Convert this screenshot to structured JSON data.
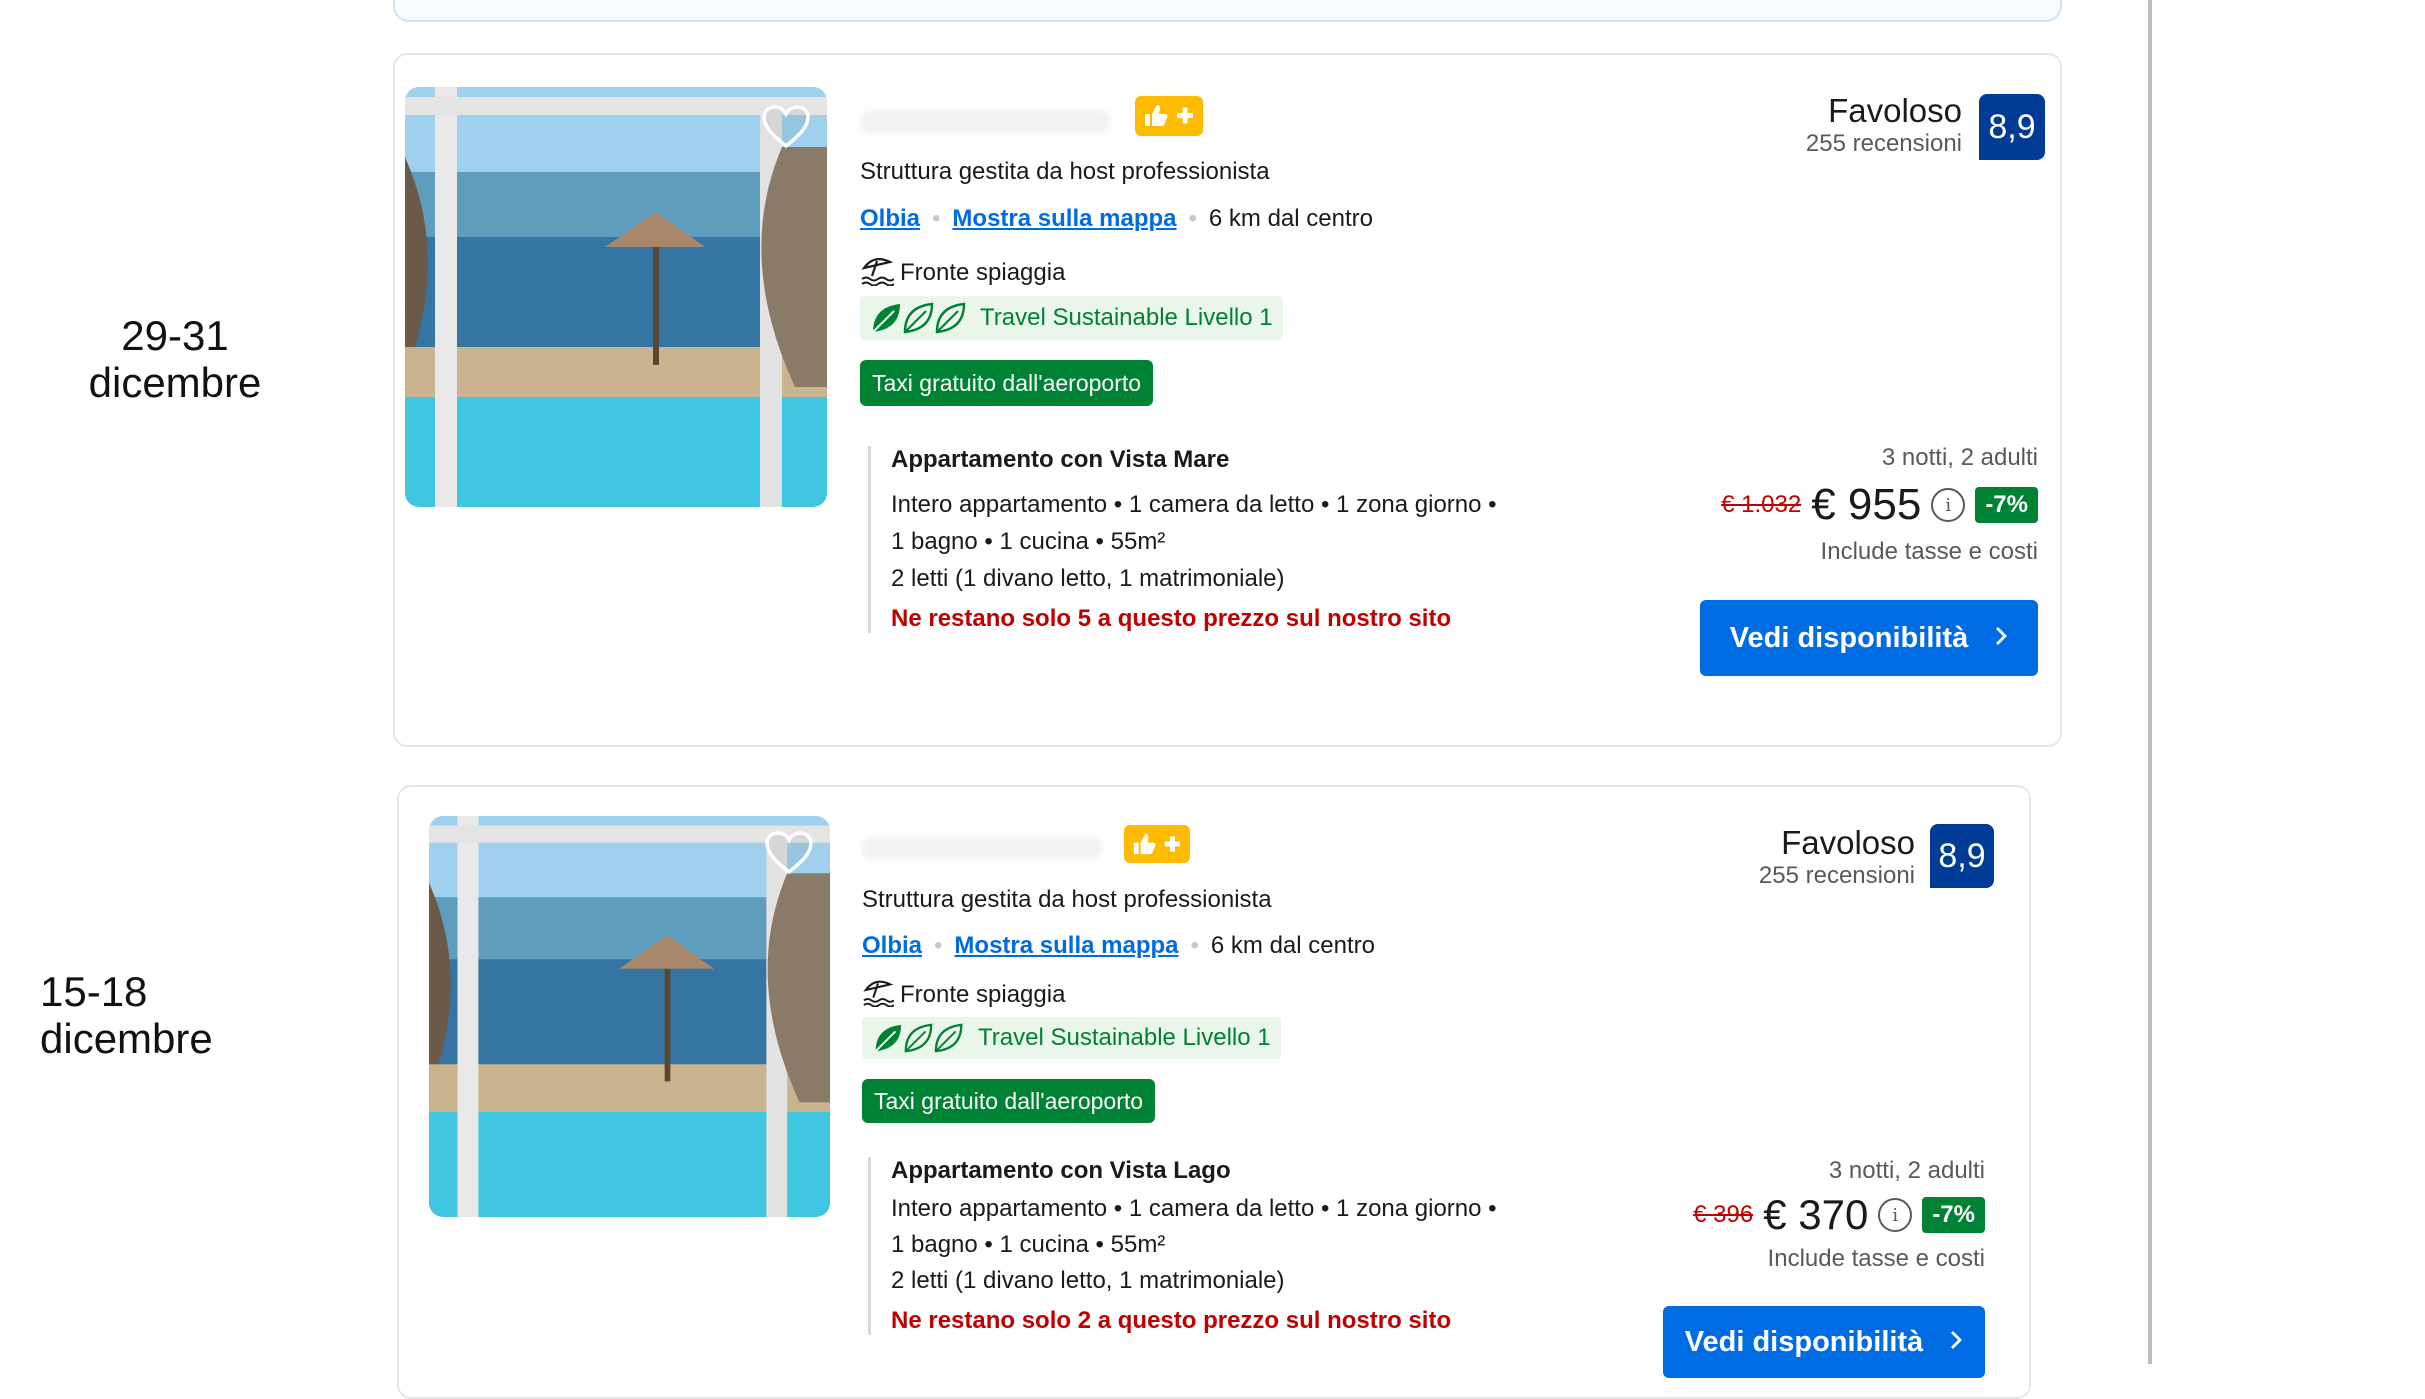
{
  "listings": [
    {
      "date_label": "29-31\ndicembre",
      "host_label": "Struttura gestita da host professionista",
      "city": "Olbia",
      "map_link": "Mostra sulla mappa",
      "distance": "6 km dal centro",
      "beach": "Fronte spiaggia",
      "sustainable": "Travel Sustainable Livello 1",
      "taxi": "Taxi gratuito dall'aeroporto",
      "room_title": "Appartamento con Vista Mare",
      "room_line1": "Intero appartamento • 1 camera da letto • 1 zona giorno •",
      "room_line2": "1 bagno • 1 cucina • 55m²",
      "room_line3": "2 letti (1 divano letto, 1 matrimoniale)",
      "scarcity": "Ne restano solo 5 a questo prezzo sul nostro sito",
      "review_word": "Favoloso",
      "review_count": "255 recensioni",
      "score": "8,9",
      "nights": "3 notti, 2 adulti",
      "old_price": "€ 1.032",
      "new_price": "€ 955",
      "discount": "-7%",
      "taxes": "Include tasse e costi",
      "cta": "Vedi disponibilità",
      "info_glyph": "i"
    },
    {
      "date_label": "15-18\ndicembre",
      "host_label": "Struttura gestita da host professionista",
      "city": "Olbia",
      "map_link": "Mostra sulla mappa",
      "distance": "6 km dal centro",
      "beach": "Fronte spiaggia",
      "sustainable": "Travel Sustainable Livello 1",
      "taxi": "Taxi gratuito dall'aeroporto",
      "room_title": "Appartamento con Vista Lago",
      "room_line1": "Intero appartamento • 1 camera da letto • 1 zona giorno •",
      "room_line2": "1 bagno • 1 cucina • 55m²",
      "room_line3": "2 letti (1 divano letto, 1 matrimoniale)",
      "scarcity": "Ne restano solo 2 a questo prezzo sul nostro sito",
      "review_word": "Favoloso",
      "review_count": "255 recensioni",
      "score": "8,9",
      "nights": "3 notti, 2 adulti",
      "old_price": "€ 396",
      "new_price": "€ 370",
      "discount": "-7%",
      "taxes": "Include tasse e costi",
      "cta": "Vedi disponibilità",
      "info_glyph": "i"
    }
  ],
  "colors": {
    "brand_blue": "#006ce4",
    "score_blue": "#003b95",
    "green": "#008234",
    "scarcity_red": "#c00000",
    "preferred_yellow": "#febb02"
  },
  "icons": {
    "favorite": "heart-icon",
    "preferred": "thumbs-up-plus-icon",
    "beach": "beach-umbrella-icon",
    "sustainability": "leaf-icon",
    "info": "info-icon",
    "chevron": "chevron-right-icon"
  }
}
